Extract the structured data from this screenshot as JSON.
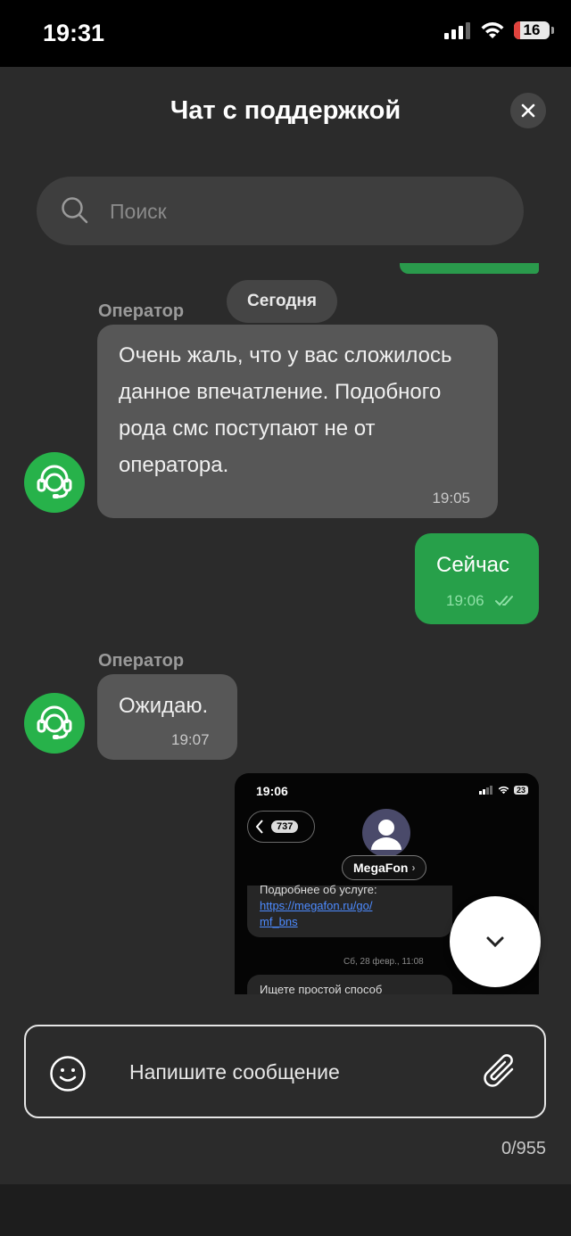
{
  "status_bar": {
    "time": "19:31",
    "battery": "16"
  },
  "header": {
    "title": "Чат с поддержкой"
  },
  "search": {
    "placeholder": "Поиск"
  },
  "chat": {
    "date_separator": "Сегодня",
    "messages": [
      {
        "sender": "Оператор",
        "text": "Очень жаль, что у вас сложилось данное впечатление. Подобного рода смс поступают не от оператора.",
        "time": "19:05"
      },
      {
        "outgoing": true,
        "text": "Сейчас",
        "time": "19:06"
      },
      {
        "sender": "Оператор",
        "text": "Ожидаю.",
        "time": "19:07"
      }
    ],
    "attachment": {
      "time": "19:06",
      "battery": "23",
      "back_count": "737",
      "contact_name": "MegaFon",
      "message_1_lead": "Подробнее об услуге:",
      "message_1_link_a": "https://megafon.ru/go/",
      "message_1_link_b": "mf_bns",
      "date": "Сб, 28 февр., 11:08",
      "message_2_lead": "Ищете простой способ"
    }
  },
  "composer": {
    "placeholder": "Напишите сообщение",
    "counter": "0/955"
  },
  "colors": {
    "accent_green": "#27a04a",
    "background": "#2b2b2b"
  },
  "icons": [
    "signal-icon",
    "wifi-icon",
    "close-icon",
    "search-icon",
    "operator-headset-icon",
    "double-check-icon",
    "chevron-down-icon",
    "emoji-icon",
    "paperclip-icon"
  ]
}
